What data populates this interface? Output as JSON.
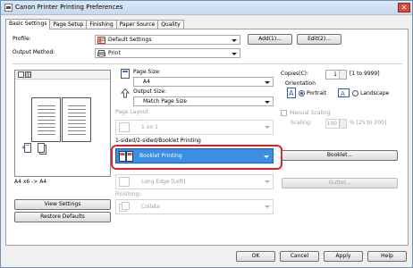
{
  "window": {
    "title": "Canon Printer Printing Preferences",
    "close_label": "✕"
  },
  "tabs": [
    {
      "label": "Basic Settings"
    },
    {
      "label": "Page Setup"
    },
    {
      "label": "Finishing"
    },
    {
      "label": "Paper Source"
    },
    {
      "label": "Quality"
    }
  ],
  "profile": {
    "label": "Profile:",
    "value": "Default Settings",
    "add_label": "Add(1)...",
    "edit_label": "Edit(2)..."
  },
  "output_method": {
    "label": "Output Method:",
    "value": "Print"
  },
  "preview": {
    "caption": "A4 x6 -> A4"
  },
  "page_size": {
    "label": "Page Size:",
    "value": "A4"
  },
  "output_size": {
    "label": "Output Size:",
    "value": "Match Page Size"
  },
  "page_layout": {
    "label": "Page Layout",
    "value": "1 on 1"
  },
  "print_style": {
    "label": "1-sided/2-sided/Booklet Printing",
    "value": "Booklet Printing",
    "booklet_button": "Booklet..."
  },
  "binding": {
    "value": "Long Edge [Left]",
    "gutter_button": "Gutter..."
  },
  "finishing": {
    "label": "Finishing:",
    "value": "Collate"
  },
  "copies": {
    "label": "Copies(C):",
    "value": "1",
    "range": "[1 to 9999]"
  },
  "orientation": {
    "label": "Orientation",
    "portrait": "Portrait",
    "landscape": "Landscape"
  },
  "manual_scaling": {
    "label": "Manual Scaling",
    "scaling_label": "Scaling:",
    "value": "100",
    "range": "% [25 to 200]"
  },
  "left_buttons": {
    "view_settings": "View Settings",
    "restore_defaults": "Restore Defaults"
  },
  "footer": {
    "ok": "OK",
    "cancel": "Cancel",
    "apply": "Apply",
    "help": "Help"
  }
}
